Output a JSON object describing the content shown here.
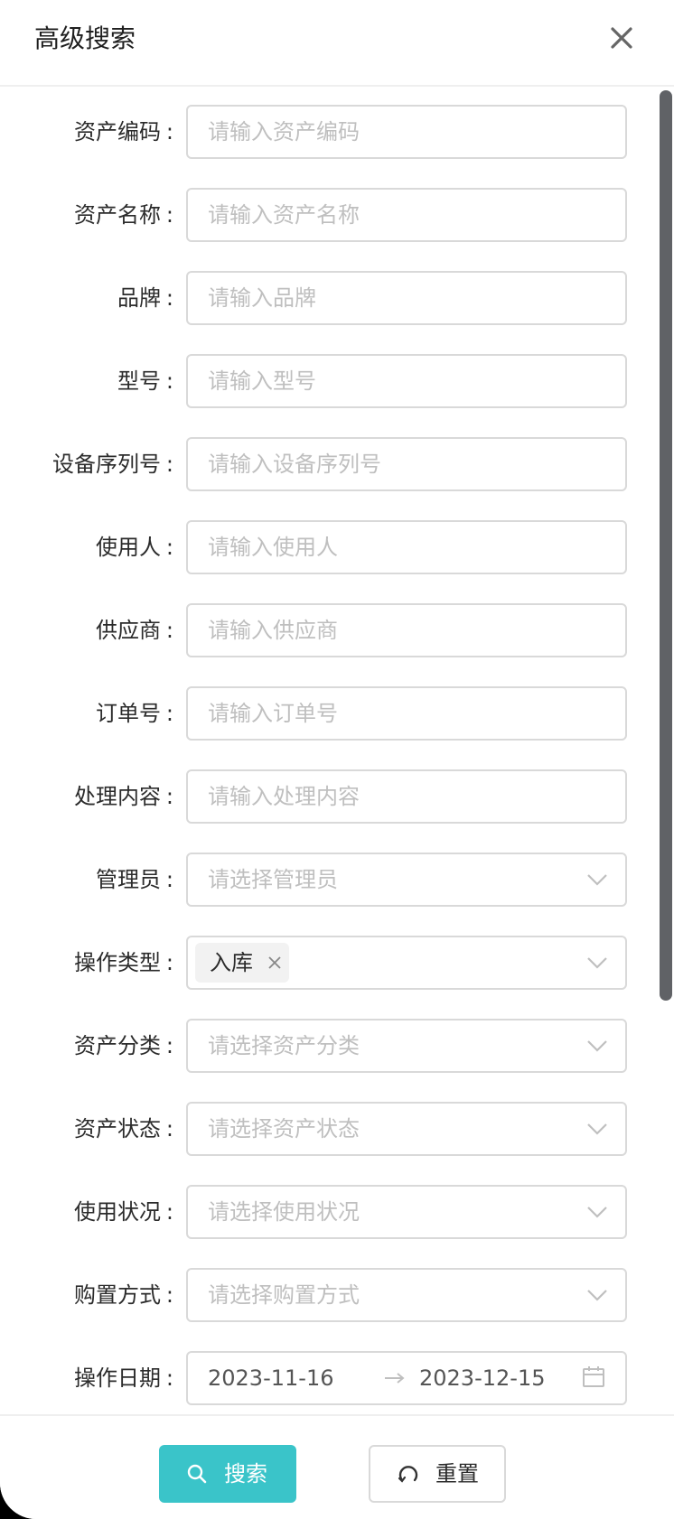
{
  "header": {
    "title": "高级搜索",
    "close_icon": "close-icon"
  },
  "colon": ":",
  "fields": {
    "asset_code": {
      "label": "资产编码",
      "placeholder": "请输入资产编码"
    },
    "asset_name": {
      "label": "资产名称",
      "placeholder": "请输入资产名称"
    },
    "brand": {
      "label": "品牌",
      "placeholder": "请输入品牌"
    },
    "model": {
      "label": "型号",
      "placeholder": "请输入型号"
    },
    "serial_number": {
      "label": "设备序列号",
      "placeholder": "请输入设备序列号"
    },
    "user": {
      "label": "使用人",
      "placeholder": "请输入使用人"
    },
    "supplier": {
      "label": "供应商",
      "placeholder": "请输入供应商"
    },
    "order_number": {
      "label": "订单号",
      "placeholder": "请输入订单号"
    },
    "processing_content": {
      "label": "处理内容",
      "placeholder": "请输入处理内容"
    },
    "administrator": {
      "label": "管理员",
      "placeholder": "请选择管理员"
    },
    "operation_type": {
      "label": "操作类型",
      "selected_tags": [
        "入库"
      ]
    },
    "asset_category": {
      "label": "资产分类",
      "placeholder": "请选择资产分类"
    },
    "asset_status": {
      "label": "资产状态",
      "placeholder": "请选择资产状态"
    },
    "usage_condition": {
      "label": "使用状况",
      "placeholder": "请选择使用状况"
    },
    "purchase_method": {
      "label": "购置方式",
      "placeholder": "请选择购置方式"
    },
    "operation_date": {
      "label": "操作日期",
      "start": "2023-11-16",
      "end": "2023-12-15"
    }
  },
  "footer": {
    "search_label": "搜索",
    "reset_label": "重置"
  },
  "icons": {
    "close": "close-icon",
    "chevron": "chevron-down-icon",
    "tag_close": "tag-close-icon",
    "arrow": "arrow-right-icon",
    "calendar": "calendar-icon",
    "search": "search-icon",
    "reset": "reset-icon"
  },
  "colors": {
    "primary": "#3ac4c9",
    "border": "#d9d9d9",
    "placeholder": "#bfbfbf",
    "text": "#2b2b2b",
    "scrollbar": "#606266"
  }
}
